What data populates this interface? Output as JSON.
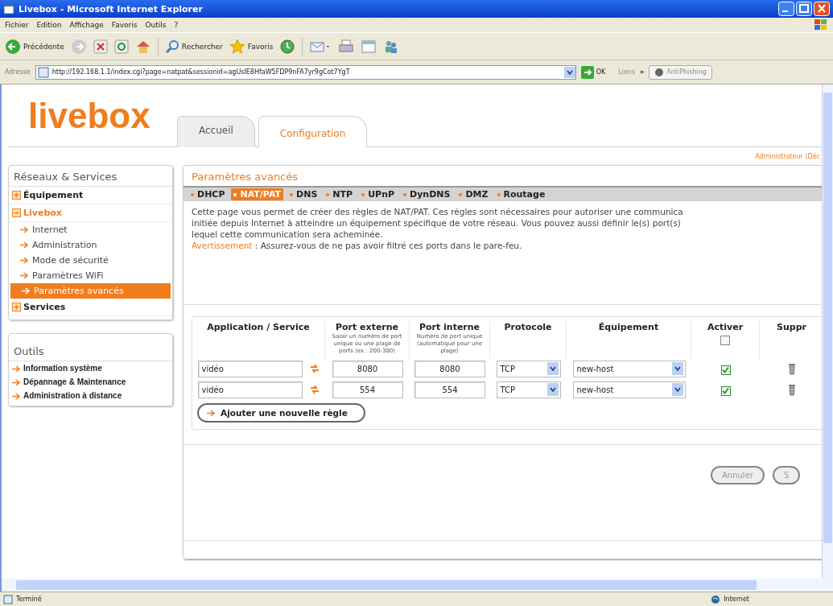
{
  "window": {
    "title": "Livebox - Microsoft Internet Explorer"
  },
  "menu": [
    "Fichier",
    "Edition",
    "Affichage",
    "Favoris",
    "Outils",
    "?"
  ],
  "toolbar": {
    "back": "Précédente",
    "search": "Rechercher",
    "favorites": "Favoris"
  },
  "address_bar": {
    "label": "Adresse",
    "url": "http://192.168.1.1/index.cgi?page=natpat&sessionid=agUsIE8HfaW5FDP9nFA7yr9gCot7YgT",
    "go": "OK",
    "links": "Liens",
    "more": "»",
    "antiphishing": "AntiPhishing"
  },
  "page": {
    "logo": "livebox",
    "tabs": [
      {
        "label": "Accueil",
        "selected": false
      },
      {
        "label": "Configuration",
        "selected": true
      }
    ],
    "user": "Administrateur (Déc",
    "sidebar": {
      "title": "Réseaux & Services",
      "items": [
        {
          "label": "Équipement",
          "expanded": false
        },
        {
          "label": "Livebox",
          "expanded": true,
          "children": [
            {
              "label": "Internet",
              "selected": false
            },
            {
              "label": "Administration",
              "selected": false
            },
            {
              "label": "Mode de sécurité",
              "selected": false
            },
            {
              "label": "Paramètres WiFi",
              "selected": false
            },
            {
              "label": "Paramètres avancés",
              "selected": true
            }
          ]
        },
        {
          "label": "Services",
          "expanded": false
        }
      ]
    },
    "tools": {
      "title": "Outils",
      "items": [
        "Information système",
        "Dépannage & Maintenance",
        "Administration à distance"
      ]
    },
    "main": {
      "title": "Paramètres avancés",
      "subtabs": [
        {
          "label": "DHCP",
          "selected": false
        },
        {
          "label": "NAT/PAT",
          "selected": true
        },
        {
          "label": "DNS",
          "selected": false
        },
        {
          "label": "NTP",
          "selected": false
        },
        {
          "label": "UPnP",
          "selected": false
        },
        {
          "label": "DynDNS",
          "selected": false
        },
        {
          "label": "DMZ",
          "selected": false
        },
        {
          "label": "Routage",
          "selected": false
        }
      ],
      "description": [
        "Cette page vous permet de créer des règles de NAT/PAT. Ces règles sont nécessaires pour autoriser une communica",
        "initiée depuis Internet à atteindre un équipement spécifique de votre réseau. Vous pouvez aussi définir le(s) port(s)",
        "lequel cette communication sera acheminée."
      ],
      "warning": {
        "label": "Avertissement",
        "text": " : Assurez-vous de ne pas avoir filtré ces ports dans le pare-feu."
      },
      "table": {
        "columns": [
          {
            "title": "Application / Service"
          },
          {
            "title": "Port externe",
            "note": "Saisir un numéro de port unique ou une plage de ports (ex : 200-300)"
          },
          {
            "title": "Port interne",
            "note": "Numéro de port unique (automatique pour une plage)"
          },
          {
            "title": "Protocole"
          },
          {
            "title": "Équipement"
          },
          {
            "title": "Activer",
            "checked": false
          },
          {
            "title": "Suppr"
          }
        ],
        "rows": [
          {
            "application": "vidéo",
            "external_port": "8080",
            "internal_port": "8080",
            "protocol": "TCP",
            "device": "new-host",
            "active": true
          },
          {
            "application": "vidéo",
            "external_port": "554",
            "internal_port": "554",
            "protocol": "TCP",
            "device": "new-host",
            "active": true
          }
        ]
      },
      "add_button": "Ajouter une nouvelle règle",
      "buttons": [
        "Annuler",
        "S"
      ]
    }
  },
  "status_bar": {
    "text": "Terminé",
    "zone": "Internet"
  }
}
